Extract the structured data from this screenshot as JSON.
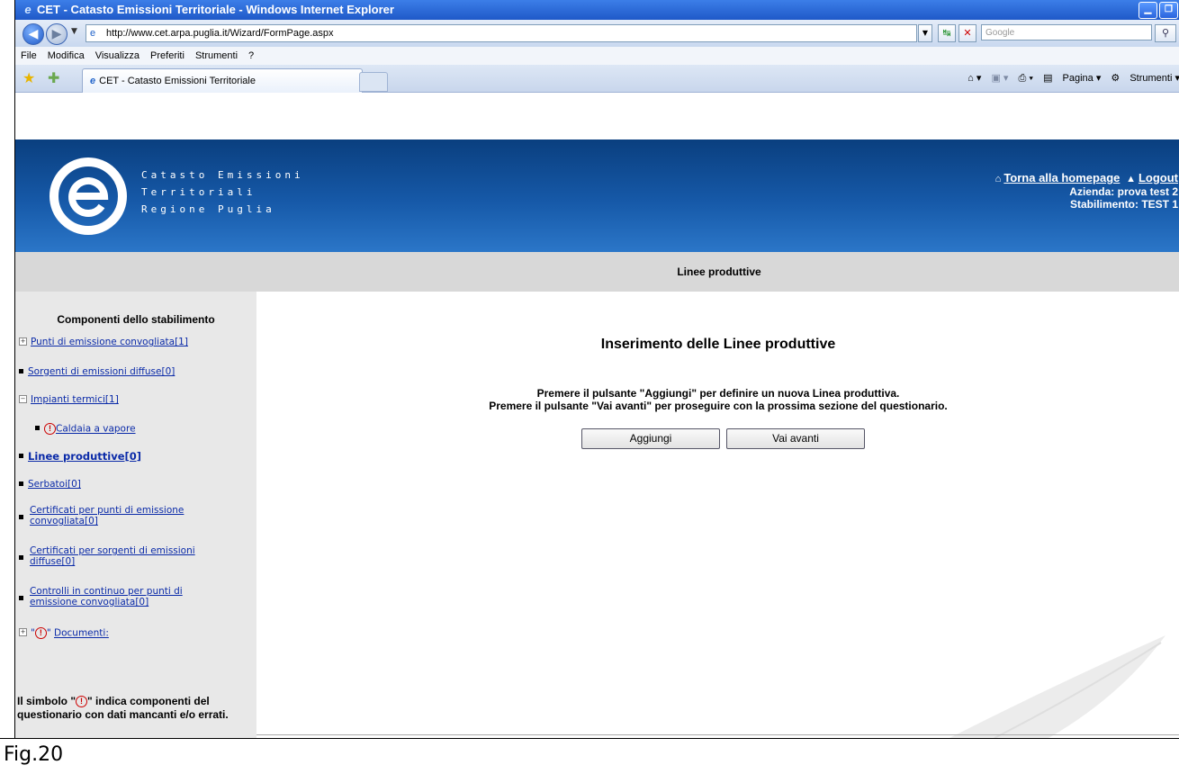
{
  "browser": {
    "window_title": "CET - Catasto Emissioni Territoriale - Windows Internet Explorer",
    "url": "http://www.cet.arpa.puglia.it/Wizard/FormPage.aspx",
    "search_placeholder": "Google",
    "menu": [
      "File",
      "Modifica",
      "Visualizza",
      "Preferiti",
      "Strumenti",
      "?"
    ],
    "tab_title": "CET - Catasto Emissioni Territoriale",
    "commands": {
      "page": "Pagina",
      "tools": "Strumenti"
    }
  },
  "header": {
    "brand_lines": [
      "Catasto Emissioni",
      "Territoriali",
      "Regione Puglia"
    ],
    "home_link": "Torna alla homepage",
    "logout_link": "Logout",
    "company": "Azienda: prova test 2",
    "plant": "Stabilimento: TEST 1"
  },
  "section_title": "Linee produttive",
  "sidebar": {
    "title": "Componenti dello stabilimento",
    "items": [
      {
        "label": "Punti di emissione convogliata[1]"
      },
      {
        "label": "Sorgenti di emissioni diffuse[0]"
      },
      {
        "label": "Impianti termici[1]"
      },
      {
        "label": "Caldaia a vapore"
      },
      {
        "label": "Linee produttive[0]"
      },
      {
        "label": "Serbatoi[0]"
      },
      {
        "label": "Certificati per punti di emissione",
        "label2": "convogliata[0]"
      },
      {
        "label": "Certificati per sorgenti di emissioni",
        "label2": "diffuse[0]"
      },
      {
        "label": "Controlli in continuo per punti di",
        "label2": "emissione convogliata[0]"
      },
      {
        "label": "Documenti:"
      }
    ],
    "note_prefix": "Il simbolo \"",
    "note_suffix": "\" indica componenti del questionario con dati mancanti e/o errati."
  },
  "main": {
    "title": "Inserimento delle Linee produttive",
    "line1": "Premere il pulsante \"Aggiungi\" per definire un nuova Linea produttiva.",
    "line2": "Premere il pulsante \"Vai avanti\" per proseguire con la prossima sezione del questionario.",
    "add_button": "Aggiungi",
    "next_button": "Vai avanti"
  },
  "caption": "Fig.20"
}
